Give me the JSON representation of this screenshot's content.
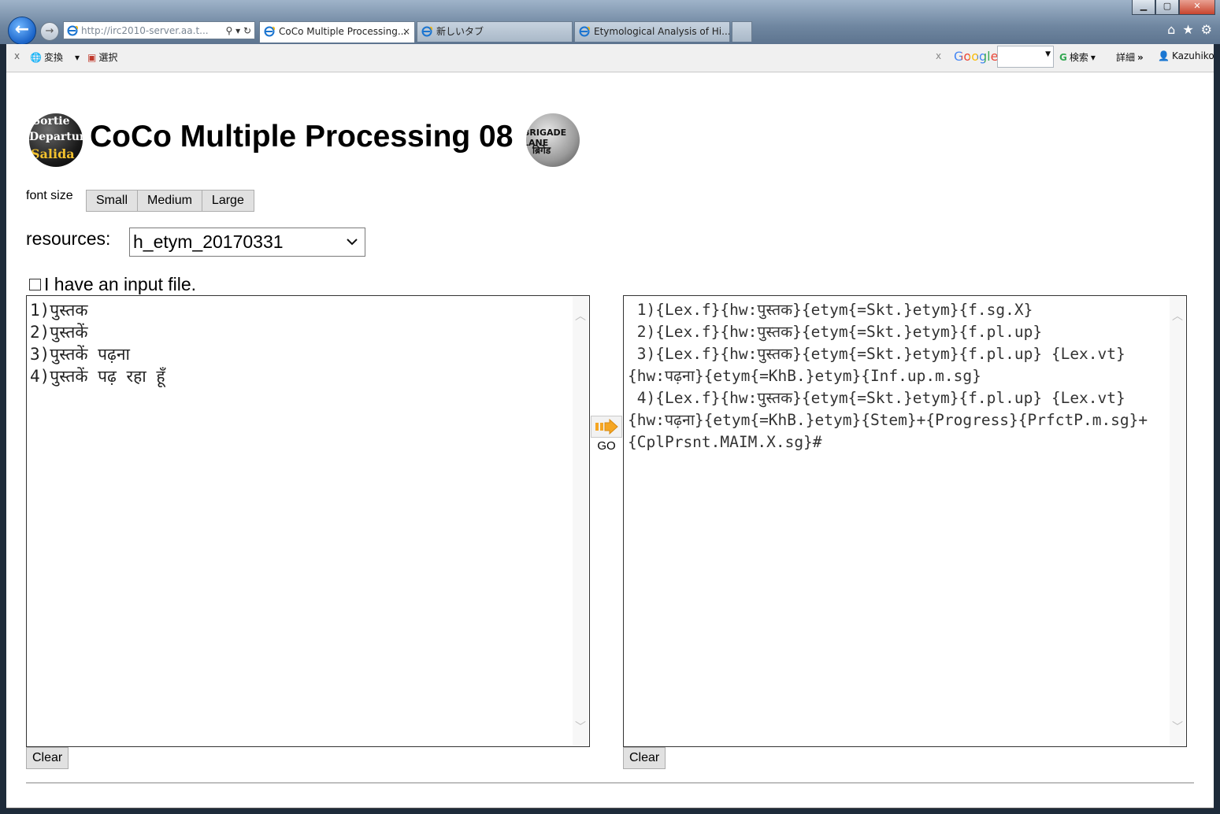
{
  "browser": {
    "address": "http://irc2010-server.aa.t...",
    "tabs": [
      {
        "label": "CoCo Multiple Processing...",
        "active": true
      },
      {
        "label": "新しいタブ",
        "active": false
      },
      {
        "label": "Etymological Analysis of Hi...",
        "active": false
      }
    ],
    "close_glyph": "×"
  },
  "command_bar": {
    "close_glyph": "x",
    "convert_label": "変換",
    "select_label": "選択",
    "google_logo": "Google",
    "search_label": "検索",
    "details_label": "詳細",
    "more_glyph": "»",
    "user_label": "Kazuhiko"
  },
  "page": {
    "title": "CoCo Multiple Processing 08",
    "font_size_label": "font size",
    "font_size_buttons": [
      "Small",
      "Medium",
      "Large"
    ],
    "resources_label": "resources:",
    "resources_selected": "h_etym_20170331",
    "input_file_label": "I have an input file.",
    "go_label": "GO",
    "clear_label": "Clear",
    "logo_left_text": [
      "Sortie",
      "Departure",
      "Salida"
    ],
    "logo_right_text": [
      "BRIGADE LANE",
      "ब्रिगेड"
    ]
  },
  "input_lines": [
    "1)पुस्तक",
    "2)पुस्तकें",
    "3)पुस्तकें पढ़ना",
    "4)पुस्तकें पढ़ रहा हूँ"
  ],
  "output_lines": [
    " 1){Lex.f}{hw:पुस्तक}{etym{=Skt.}etym}{f.sg.X}",
    " 2){Lex.f}{hw:पुस्तक}{etym{=Skt.}etym}{f.pl.up}",
    " 3){Lex.f}{hw:पुस्तक}{etym{=Skt.}etym}{f.pl.up} {Lex.vt}{hw:पढ़ना}{etym{=KhB.}etym}{Inf.up.m.sg}",
    " 4){Lex.f}{hw:पुस्तक}{etym{=Skt.}etym}{f.pl.up} {Lex.vt}{hw:पढ़ना}{etym{=KhB.}etym}{Stem}+{Progress}{PrfctP.m.sg}+{CplPrsnt.MAIM.X.sg}#"
  ],
  "colors": {
    "accent_blue": "#1b64c8",
    "go_arrow": "#f5a623"
  }
}
